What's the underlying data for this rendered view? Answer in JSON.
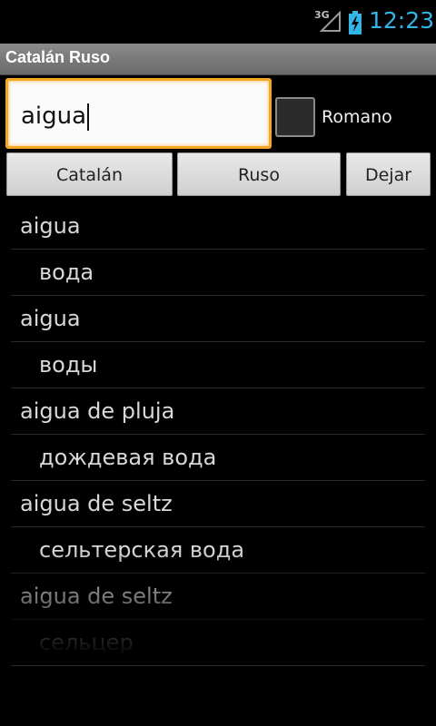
{
  "status": {
    "network": "3G",
    "time": "12:23"
  },
  "app": {
    "title": "Catalán Ruso"
  },
  "search": {
    "value": "aigua",
    "romano_label": "Romano",
    "romano_checked": false
  },
  "buttons": {
    "catalan": "Catalán",
    "ruso": "Ruso",
    "dejar": "Dejar"
  },
  "results": [
    {
      "term": "aigua",
      "translation": "вода"
    },
    {
      "term": "aigua",
      "translation": "воды"
    },
    {
      "term": "aigua de pluja",
      "translation": "дождевая вода"
    },
    {
      "term": "aigua de seltz",
      "translation": "сельтерская вода"
    },
    {
      "term": "aigua de seltz",
      "translation": "сельцер"
    }
  ],
  "colors": {
    "accent": "#33b5e5",
    "focus": "#f5a623"
  }
}
